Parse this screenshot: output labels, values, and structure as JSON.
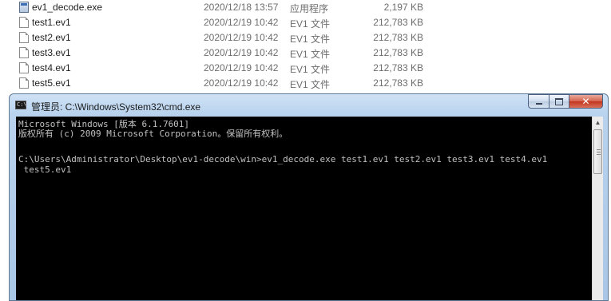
{
  "explorer": {
    "files": [
      {
        "name": "ev1_decode.exe",
        "date": "2020/12/18 13:57",
        "type": "应用程序",
        "size": "2,197 KB",
        "icon": "exe-icon"
      },
      {
        "name": "test1.ev1",
        "date": "2020/12/19 10:42",
        "type": "EV1 文件",
        "size": "212,783 KB",
        "icon": "file-icon"
      },
      {
        "name": "test2.ev1",
        "date": "2020/12/19 10:42",
        "type": "EV1 文件",
        "size": "212,783 KB",
        "icon": "file-icon"
      },
      {
        "name": "test3.ev1",
        "date": "2020/12/19 10:42",
        "type": "EV1 文件",
        "size": "212,783 KB",
        "icon": "file-icon"
      },
      {
        "name": "test4.ev1",
        "date": "2020/12/19 10:42",
        "type": "EV1 文件",
        "size": "212,783 KB",
        "icon": "file-icon"
      },
      {
        "name": "test5.ev1",
        "date": "2020/12/19 10:42",
        "type": "EV1 文件",
        "size": "212,783 KB",
        "icon": "file-icon"
      }
    ]
  },
  "cmd": {
    "title": "管理员: C:\\Windows\\System32\\cmd.exe",
    "icon_text": "C:\\",
    "buttons": {
      "minimize": "minimize-icon",
      "maximize": "maximize-icon",
      "close": "✕"
    },
    "lines": [
      "Microsoft Windows [版本 6.1.7601]",
      "版权所有 (c) 2009 Microsoft Corporation。保留所有权利。",
      "",
      "C:\\Users\\Administrator\\Desktop\\ev1-decode\\win>ev1_decode.exe test1.ev1 test2.ev1 test3.ev1 test4.ev1",
      " test5.ev1"
    ],
    "scrollbar": {
      "up": "▲",
      "down": "▼"
    }
  }
}
